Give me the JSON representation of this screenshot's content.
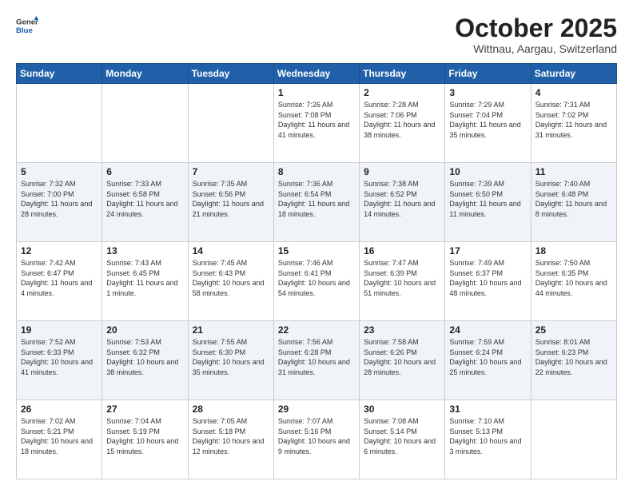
{
  "header": {
    "logo_general": "General",
    "logo_blue": "Blue",
    "month": "October 2025",
    "location": "Wittnau, Aargau, Switzerland"
  },
  "weekdays": [
    "Sunday",
    "Monday",
    "Tuesday",
    "Wednesday",
    "Thursday",
    "Friday",
    "Saturday"
  ],
  "weeks": [
    [
      {
        "day": "",
        "info": ""
      },
      {
        "day": "",
        "info": ""
      },
      {
        "day": "",
        "info": ""
      },
      {
        "day": "1",
        "info": "Sunrise: 7:26 AM\nSunset: 7:08 PM\nDaylight: 11 hours\nand 41 minutes."
      },
      {
        "day": "2",
        "info": "Sunrise: 7:28 AM\nSunset: 7:06 PM\nDaylight: 11 hours\nand 38 minutes."
      },
      {
        "day": "3",
        "info": "Sunrise: 7:29 AM\nSunset: 7:04 PM\nDaylight: 11 hours\nand 35 minutes."
      },
      {
        "day": "4",
        "info": "Sunrise: 7:31 AM\nSunset: 7:02 PM\nDaylight: 11 hours\nand 31 minutes."
      }
    ],
    [
      {
        "day": "5",
        "info": "Sunrise: 7:32 AM\nSunset: 7:00 PM\nDaylight: 11 hours\nand 28 minutes."
      },
      {
        "day": "6",
        "info": "Sunrise: 7:33 AM\nSunset: 6:58 PM\nDaylight: 11 hours\nand 24 minutes."
      },
      {
        "day": "7",
        "info": "Sunrise: 7:35 AM\nSunset: 6:56 PM\nDaylight: 11 hours\nand 21 minutes."
      },
      {
        "day": "8",
        "info": "Sunrise: 7:36 AM\nSunset: 6:54 PM\nDaylight: 11 hours\nand 18 minutes."
      },
      {
        "day": "9",
        "info": "Sunrise: 7:38 AM\nSunset: 6:52 PM\nDaylight: 11 hours\nand 14 minutes."
      },
      {
        "day": "10",
        "info": "Sunrise: 7:39 AM\nSunset: 6:50 PM\nDaylight: 11 hours\nand 11 minutes."
      },
      {
        "day": "11",
        "info": "Sunrise: 7:40 AM\nSunset: 6:48 PM\nDaylight: 11 hours\nand 8 minutes."
      }
    ],
    [
      {
        "day": "12",
        "info": "Sunrise: 7:42 AM\nSunset: 6:47 PM\nDaylight: 11 hours\nand 4 minutes."
      },
      {
        "day": "13",
        "info": "Sunrise: 7:43 AM\nSunset: 6:45 PM\nDaylight: 11 hours\nand 1 minute."
      },
      {
        "day": "14",
        "info": "Sunrise: 7:45 AM\nSunset: 6:43 PM\nDaylight: 10 hours\nand 58 minutes."
      },
      {
        "day": "15",
        "info": "Sunrise: 7:46 AM\nSunset: 6:41 PM\nDaylight: 10 hours\nand 54 minutes."
      },
      {
        "day": "16",
        "info": "Sunrise: 7:47 AM\nSunset: 6:39 PM\nDaylight: 10 hours\nand 51 minutes."
      },
      {
        "day": "17",
        "info": "Sunrise: 7:49 AM\nSunset: 6:37 PM\nDaylight: 10 hours\nand 48 minutes."
      },
      {
        "day": "18",
        "info": "Sunrise: 7:50 AM\nSunset: 6:35 PM\nDaylight: 10 hours\nand 44 minutes."
      }
    ],
    [
      {
        "day": "19",
        "info": "Sunrise: 7:52 AM\nSunset: 6:33 PM\nDaylight: 10 hours\nand 41 minutes."
      },
      {
        "day": "20",
        "info": "Sunrise: 7:53 AM\nSunset: 6:32 PM\nDaylight: 10 hours\nand 38 minutes."
      },
      {
        "day": "21",
        "info": "Sunrise: 7:55 AM\nSunset: 6:30 PM\nDaylight: 10 hours\nand 35 minutes."
      },
      {
        "day": "22",
        "info": "Sunrise: 7:56 AM\nSunset: 6:28 PM\nDaylight: 10 hours\nand 31 minutes."
      },
      {
        "day": "23",
        "info": "Sunrise: 7:58 AM\nSunset: 6:26 PM\nDaylight: 10 hours\nand 28 minutes."
      },
      {
        "day": "24",
        "info": "Sunrise: 7:59 AM\nSunset: 6:24 PM\nDaylight: 10 hours\nand 25 minutes."
      },
      {
        "day": "25",
        "info": "Sunrise: 8:01 AM\nSunset: 6:23 PM\nDaylight: 10 hours\nand 22 minutes."
      }
    ],
    [
      {
        "day": "26",
        "info": "Sunrise: 7:02 AM\nSunset: 5:21 PM\nDaylight: 10 hours\nand 18 minutes."
      },
      {
        "day": "27",
        "info": "Sunrise: 7:04 AM\nSunset: 5:19 PM\nDaylight: 10 hours\nand 15 minutes."
      },
      {
        "day": "28",
        "info": "Sunrise: 7:05 AM\nSunset: 5:18 PM\nDaylight: 10 hours\nand 12 minutes."
      },
      {
        "day": "29",
        "info": "Sunrise: 7:07 AM\nSunset: 5:16 PM\nDaylight: 10 hours\nand 9 minutes."
      },
      {
        "day": "30",
        "info": "Sunrise: 7:08 AM\nSunset: 5:14 PM\nDaylight: 10 hours\nand 6 minutes."
      },
      {
        "day": "31",
        "info": "Sunrise: 7:10 AM\nSunset: 5:13 PM\nDaylight: 10 hours\nand 3 minutes."
      },
      {
        "day": "",
        "info": ""
      }
    ]
  ]
}
